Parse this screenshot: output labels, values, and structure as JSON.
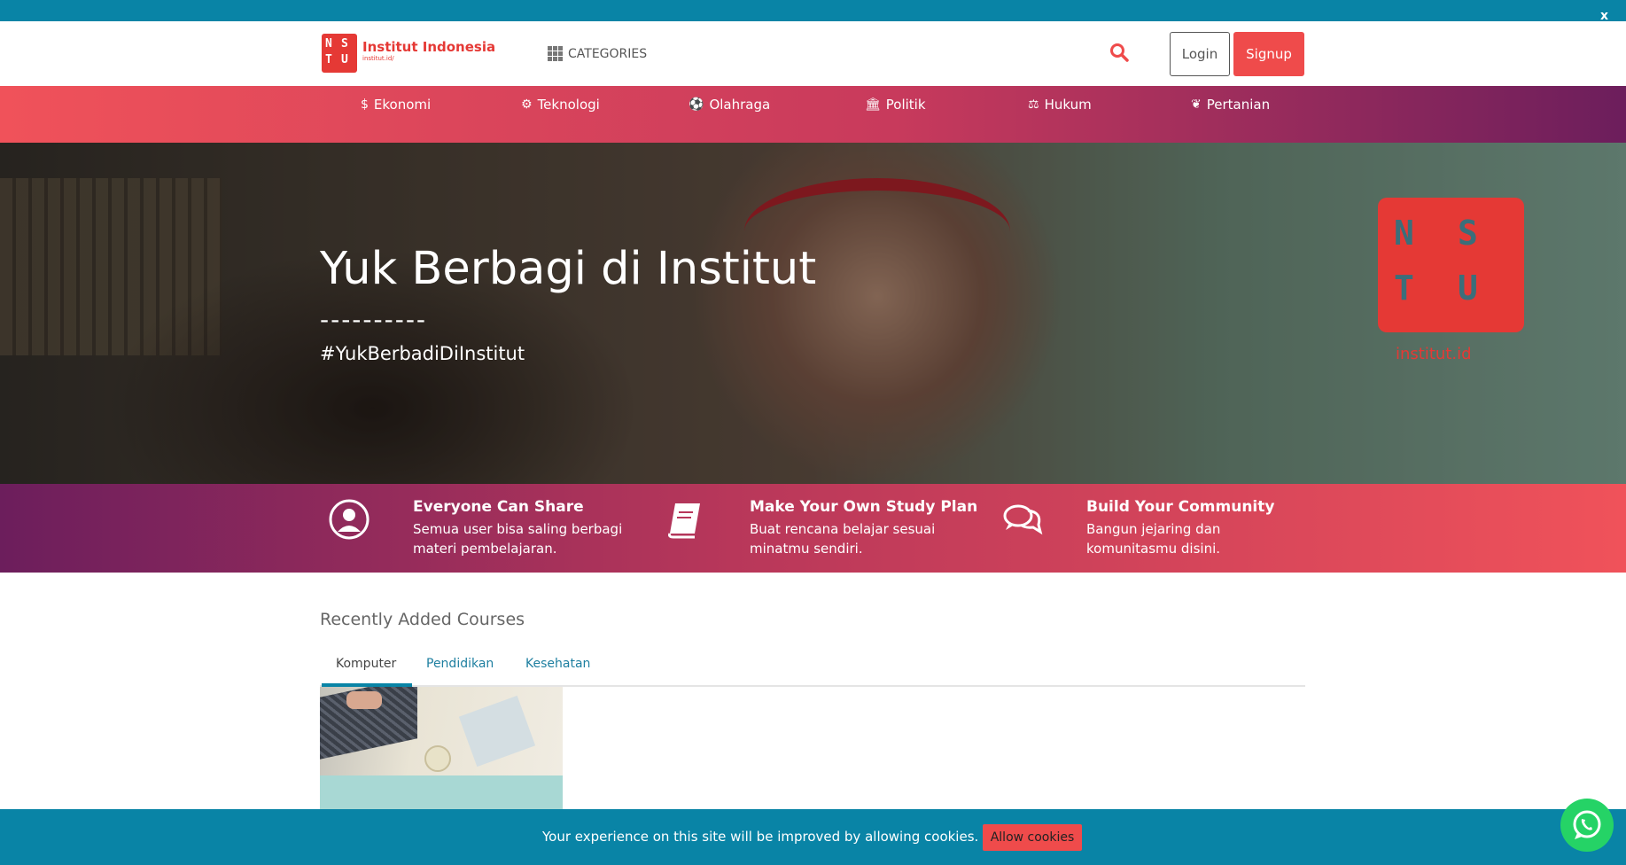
{
  "topbar": {
    "close_label": "x"
  },
  "header": {
    "logo_name": "Institut Indonesia",
    "logo_sub": "institut.id/",
    "categories_label": "CATEGORIES",
    "login_label": "Login",
    "signup_label": "Signup"
  },
  "catnav": {
    "items": [
      {
        "label": "Ekonomi",
        "icon": "$"
      },
      {
        "label": "Teknologi",
        "icon": "⚙"
      },
      {
        "label": "Olahraga",
        "icon": "⚽"
      },
      {
        "label": "Politik",
        "icon": "🏛"
      },
      {
        "label": "Hukum",
        "icon": "⚖"
      },
      {
        "label": "Pertanian",
        "icon": "❦"
      }
    ]
  },
  "hero": {
    "title": "Yuk Berbagi di Institut",
    "divider": "----------",
    "hashtag": "#YukBerbadiDiInstitut",
    "logo_watermark": "institut.id"
  },
  "features": [
    {
      "title": "Everyone Can Share",
      "desc": "Semua user bisa saling berbagi materi pembelajaran."
    },
    {
      "title": "Make Your Own Study Plan",
      "desc": "Buat rencana belajar sesuai minatmu sendiri."
    },
    {
      "title": "Build Your Community",
      "desc": "Bangun jejaring dan komunitasmu disini."
    }
  ],
  "courses": {
    "title": "Recently Added Courses",
    "tabs": [
      "Komputer",
      "Pendidikan",
      "Kesehatan"
    ],
    "active_tab": "Komputer"
  },
  "cookie": {
    "message": "Your experience on this site will be improved by allowing cookies.",
    "allow_label": "Allow cookies"
  },
  "colors": {
    "primary": "#0984a6",
    "accent": "#ef4b4b",
    "brand_red": "#e53935",
    "gradient_purple": "#6c1e5c",
    "whatsapp": "#25d366"
  }
}
